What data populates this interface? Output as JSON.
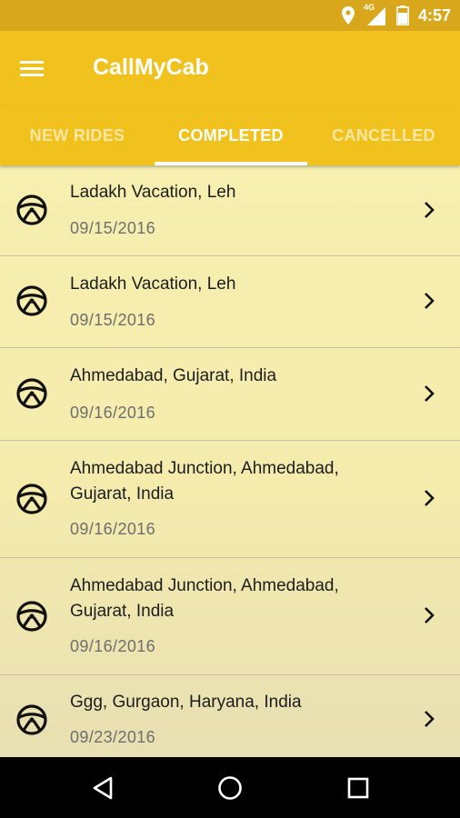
{
  "status_bar": {
    "time": "4:57",
    "network_label": "4G",
    "icons": [
      "location-pin-icon",
      "signal-icon",
      "battery-icon"
    ]
  },
  "app_bar": {
    "title": "CallMyCab",
    "menu_icon": "hamburger-menu-icon"
  },
  "tabs": [
    {
      "label": "NEW RIDES",
      "selected": false
    },
    {
      "label": "COMPLETED",
      "selected": true
    },
    {
      "label": "CANCELLED",
      "selected": false
    }
  ],
  "rides": [
    {
      "title": "Ladakh Vacation, Leh",
      "date": "09/15/2016"
    },
    {
      "title": "Ladakh Vacation, Leh",
      "date": "09/15/2016"
    },
    {
      "title": "Ahmedabad, Gujarat, India",
      "date": "09/16/2016"
    },
    {
      "title": "Ahmedabad Junction, Ahmedabad, Gujarat, India",
      "date": "09/16/2016"
    },
    {
      "title": "Ahmedabad Junction, Ahmedabad, Gujarat, India",
      "date": "09/16/2016"
    },
    {
      "title": "Ggg, Gurgaon, Haryana, India",
      "date": "09/23/2016"
    }
  ],
  "row_icon": "steering-wheel-icon",
  "row_action_icon": "chevron-right-icon",
  "nav_bar": {
    "buttons": [
      "back-icon",
      "home-icon",
      "recents-icon"
    ]
  },
  "colors": {
    "status_bar": "#d8a71c",
    "app_bar": "#f1c21d",
    "list_background": "#f6eeb0",
    "inactive_tab_text": "#fbe7a4"
  }
}
